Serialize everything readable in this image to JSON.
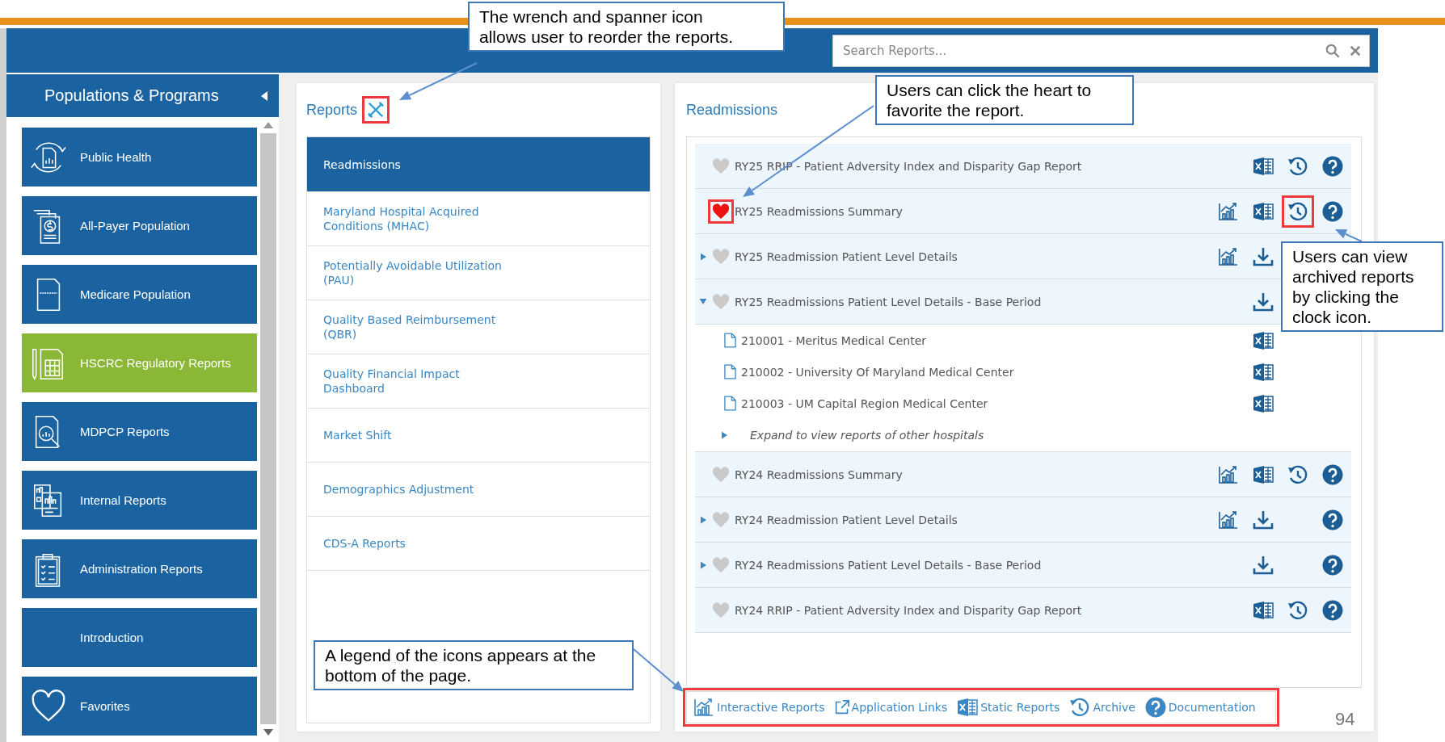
{
  "search": {
    "placeholder": "Search Reports..."
  },
  "sidebar": {
    "title": "Populations & Programs",
    "items": [
      {
        "label": "Public Health",
        "selected": false
      },
      {
        "label": "All-Payer Population",
        "selected": false
      },
      {
        "label": "Medicare Population",
        "selected": false
      },
      {
        "label": "HSCRC Regulatory Reports",
        "selected": true
      },
      {
        "label": "MDPCP Reports",
        "selected": false
      },
      {
        "label": "Internal Reports",
        "selected": false
      },
      {
        "label": "Administration Reports",
        "selected": false
      },
      {
        "label": "Introduction",
        "selected": false
      },
      {
        "label": "Favorites",
        "selected": false
      }
    ]
  },
  "reports_panel": {
    "title": "Reports",
    "tool_highlighted": true,
    "items": [
      {
        "label": "Readmissions",
        "selected": true
      },
      {
        "label": "Maryland Hospital Acquired Conditions (MHAC)",
        "selected": false
      },
      {
        "label": "Potentially Avoidable Utilization (PAU)",
        "selected": false
      },
      {
        "label": "Quality Based Reimbursement (QBR)",
        "selected": false
      },
      {
        "label": "Quality Financial Impact Dashboard",
        "selected": false
      },
      {
        "label": "Market Shift",
        "selected": false
      },
      {
        "label": "Demographics Adjustment",
        "selected": false
      },
      {
        "label": "CDS-A Reports",
        "selected": false
      }
    ]
  },
  "detail_panel": {
    "title": "Readmissions",
    "rows": [
      {
        "kind": "report",
        "label": "RY25 RRIP - Patient Adversity Index and Disparity Gap Report",
        "favorite": false,
        "interactive": false,
        "excel": true,
        "archive": true,
        "documentation": true
      },
      {
        "kind": "report",
        "label": "RY25 Readmissions Summary",
        "favorite": true,
        "favorite_highlighted": true,
        "archive_highlighted": true,
        "interactive": true,
        "excel": true,
        "archive": true,
        "documentation": true
      },
      {
        "kind": "report",
        "label": "RY25 Readmission Patient Level Details",
        "favorite": false,
        "expanded": false,
        "interactive": true,
        "excel": false,
        "download": true,
        "archive": false,
        "documentation": false
      },
      {
        "kind": "report",
        "label": "RY25 Readmissions Patient Level Details - Base Period",
        "favorite": false,
        "expanded": true,
        "interactive": false,
        "excel": false,
        "download": true,
        "archive": false,
        "documentation": false
      },
      {
        "kind": "file",
        "label": "210001 - Meritus Medical Center",
        "excel": true
      },
      {
        "kind": "file",
        "label": "210002 - University Of Maryland Medical Center",
        "excel": true
      },
      {
        "kind": "file",
        "label": "210003 - UM Capital Region Medical Center",
        "excel": true
      },
      {
        "kind": "more",
        "label": "Expand to view reports of other hospitals",
        "expanded": false
      },
      {
        "kind": "report",
        "label": "RY24 Readmissions Summary",
        "favorite": false,
        "interactive": true,
        "excel": true,
        "archive": true,
        "documentation": true
      },
      {
        "kind": "report",
        "label": "RY24 Readmission Patient Level Details",
        "favorite": false,
        "expanded": false,
        "interactive": true,
        "excel": false,
        "download": true,
        "archive": false,
        "documentation": true
      },
      {
        "kind": "report",
        "label": "RY24 Readmissions Patient Level Details - Base Period",
        "favorite": false,
        "expanded": false,
        "interactive": false,
        "excel": false,
        "download": true,
        "archive": false,
        "documentation": true
      },
      {
        "kind": "report",
        "label": "RY24 RRIP - Patient Adversity Index and Disparity Gap Report",
        "favorite": false,
        "interactive": false,
        "excel": true,
        "archive": true,
        "documentation": true
      }
    ]
  },
  "legend": {
    "highlighted": true,
    "items": [
      {
        "kind": "interactive",
        "label": "Interactive Reports"
      },
      {
        "kind": "link",
        "label": "Application Links"
      },
      {
        "kind": "static",
        "label": "Static Reports"
      },
      {
        "kind": "archive",
        "label": "Archive"
      },
      {
        "kind": "documentation",
        "label": "Documentation"
      }
    ]
  },
  "callouts": [
    {
      "text": "The wrench and spanner icon allows user to reorder the reports."
    },
    {
      "text": "Users can click the heart to favorite the report."
    },
    {
      "text": "Users can view archived reports by clicking the clock icon."
    },
    {
      "text": "A legend of the icons appears at the bottom of the page."
    }
  ],
  "page_number": "94"
}
